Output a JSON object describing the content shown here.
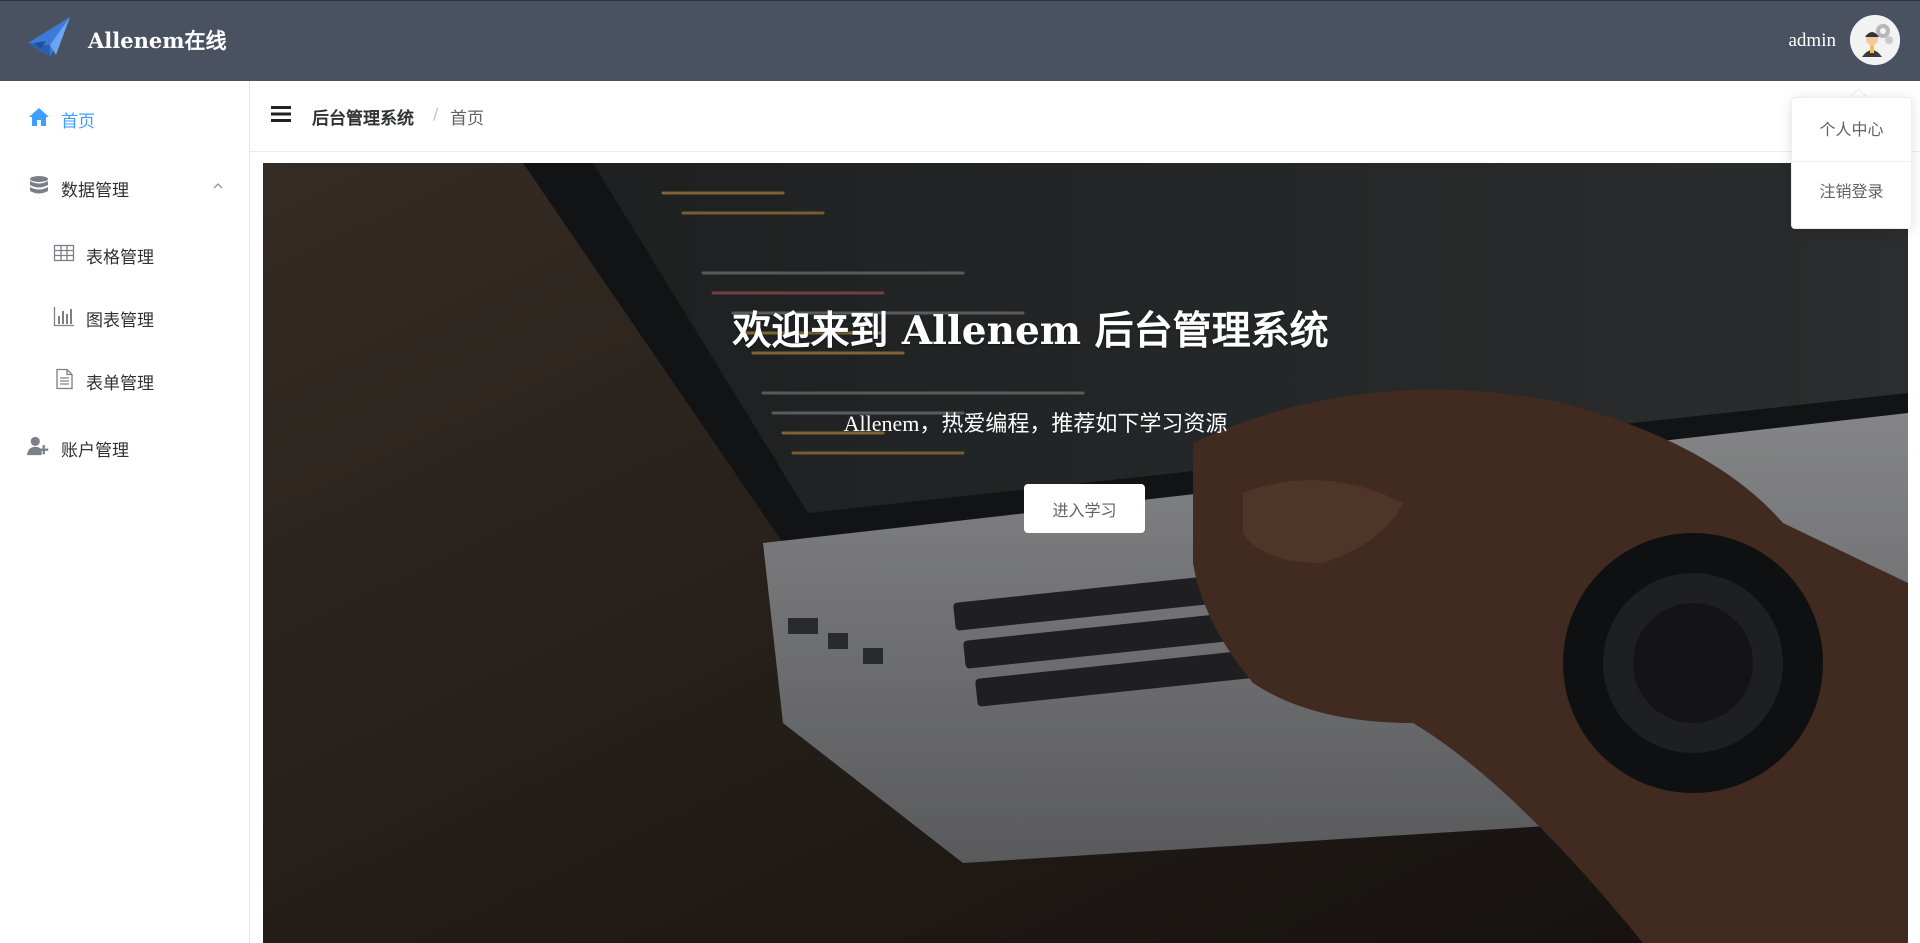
{
  "header": {
    "brand": "Allenem在线",
    "username": "admin",
    "logo_icon": "paper-bird-logo",
    "avatar_icon": "user-avatar-gear"
  },
  "sidebar": {
    "items": [
      {
        "label": "首页",
        "icon": "home-icon",
        "active": true
      },
      {
        "label": "数据管理",
        "icon": "database-icon",
        "expanded": true
      },
      {
        "label": "表格管理",
        "icon": "table-icon",
        "child": true
      },
      {
        "label": "图表管理",
        "icon": "bar-chart-icon",
        "child": true
      },
      {
        "label": "表单管理",
        "icon": "document-icon",
        "child": true
      },
      {
        "label": "账户管理",
        "icon": "user-add-icon"
      }
    ]
  },
  "breadcrumb": {
    "root": "后台管理系统",
    "separator": "/",
    "current": "首页"
  },
  "hero": {
    "title": "欢迎来到 Allenem 后台管理系统",
    "subtitle": "Allenem，热爱编程，推荐如下学习资源",
    "button": "进入学习"
  },
  "dropdown": {
    "items": [
      "个人中心",
      "注销登录"
    ]
  },
  "colors": {
    "header_bg": "#4a5262",
    "accent": "#409eff"
  }
}
